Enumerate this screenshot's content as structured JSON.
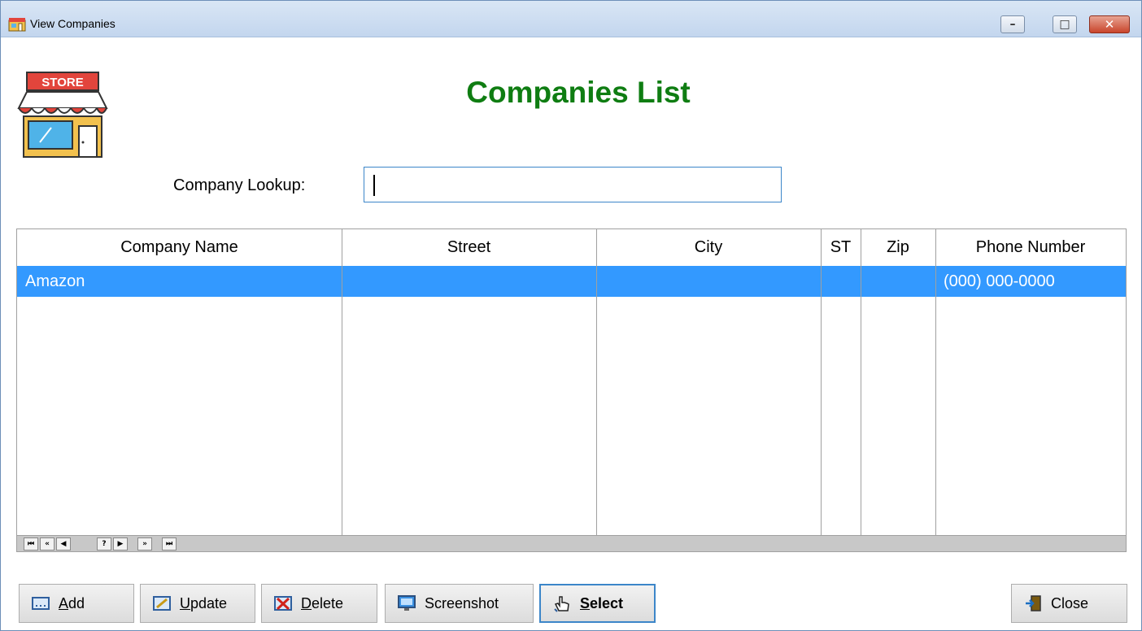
{
  "window": {
    "title": "View Companies",
    "minimize": "–",
    "maximize": "□",
    "close": "✕"
  },
  "page": {
    "heading": "Companies List",
    "lookup_label": "Company Lookup:",
    "lookup_value": "",
    "store_sign": "STORE"
  },
  "grid": {
    "columns": [
      "Company Name",
      "Street",
      "City",
      "ST",
      "Zip",
      "Phone Number"
    ],
    "rows": [
      {
        "company_name": "Amazon",
        "street": "",
        "city": "",
        "st": "",
        "zip": "",
        "phone": "(000) 000-0000",
        "selected": true
      }
    ],
    "navigator": [
      "⏮",
      "«",
      "◀",
      "?",
      "▶",
      "»",
      "⏭"
    ]
  },
  "buttons": {
    "add": {
      "pre": "",
      "u": "A",
      "post": "dd",
      "icon": "add-icon"
    },
    "update": {
      "pre": "",
      "u": "U",
      "post": "pdate",
      "icon": "update-icon"
    },
    "delete": {
      "pre": "",
      "u": "D",
      "post": "elete",
      "icon": "delete-icon"
    },
    "screenshot": {
      "pre": "Screenshot",
      "u": "",
      "post": "",
      "icon": "screenshot-icon"
    },
    "select": {
      "pre": "",
      "u": "S",
      "post": "elect",
      "icon": "hand-pointer-icon"
    },
    "close": {
      "pre": "Close",
      "u": "",
      "post": "",
      "icon": "exit-door-icon"
    }
  },
  "colors": {
    "heading": "#0f7d12",
    "selection": "#3399ff",
    "focus_border": "#3c86c9"
  }
}
